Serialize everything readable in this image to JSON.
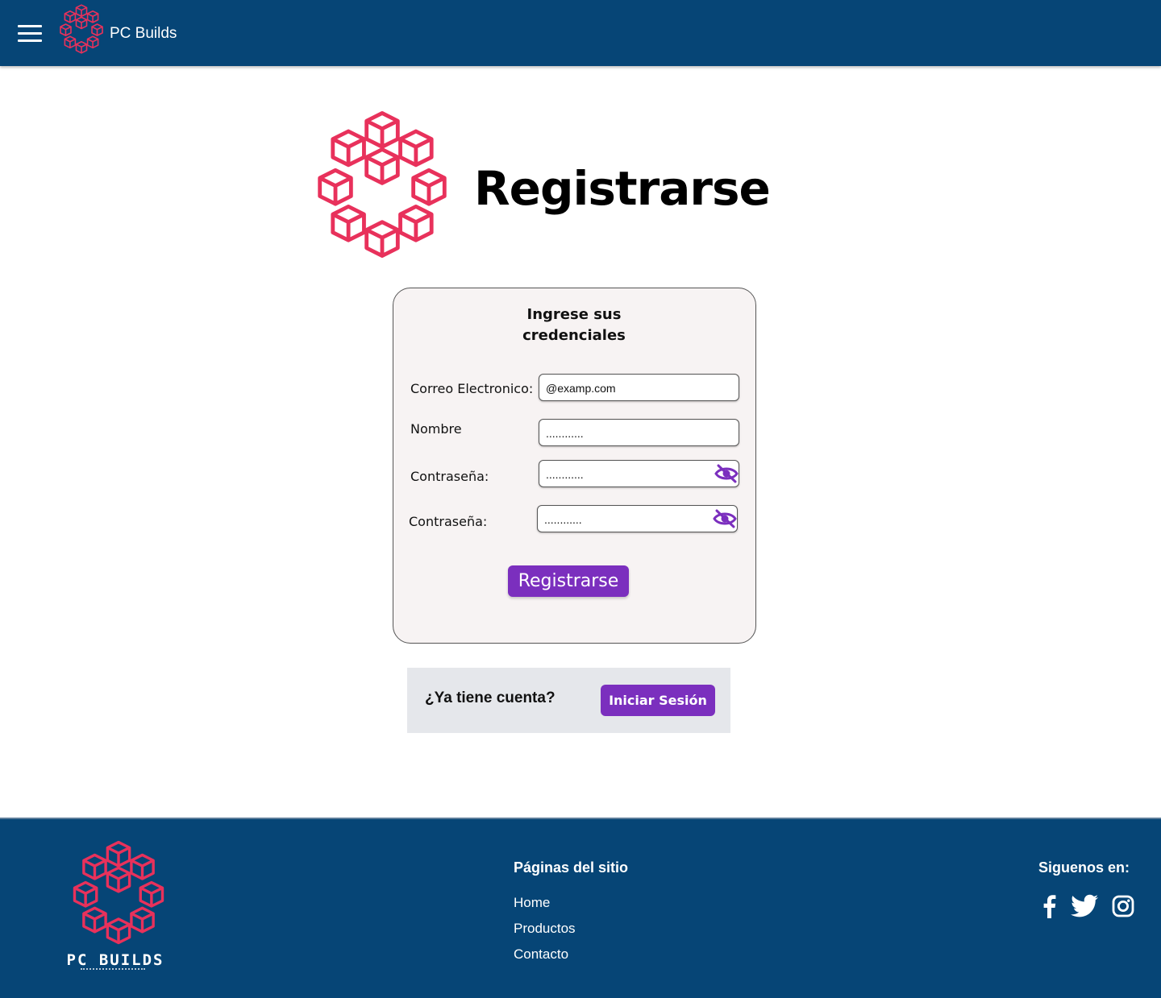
{
  "header": {
    "brand": "PC Builds"
  },
  "hero": {
    "title": "Registrarse"
  },
  "form": {
    "title_line1": "Ingrese sus",
    "title_line2": "credenciales",
    "email_label": "Correo Electronico:",
    "email_value": "@examp.com",
    "name_label": "Nombre",
    "name_value": "............",
    "password_label": "Contraseña:",
    "password_value": "............",
    "confirm_label": "Contraseña:",
    "confirm_value": "............",
    "submit_label": "Registrarse"
  },
  "login": {
    "question": "¿Ya tiene cuenta?",
    "button_label": "Iniciar Sesión"
  },
  "footer": {
    "brand": "PC BUILDS",
    "pages_heading": "Páginas del sitio",
    "links": [
      "Home",
      "Productos",
      "Contacto"
    ],
    "social_heading": "Siguenos en:",
    "social_icons": [
      "facebook-icon",
      "twitter-icon",
      "instagram-icon"
    ]
  },
  "colors": {
    "header_bg": "#064576",
    "accent": "#7b2fbe",
    "logo": "#e8315b",
    "card_bg": "#f7f3f3",
    "panel_bg": "#e5e7eb"
  }
}
